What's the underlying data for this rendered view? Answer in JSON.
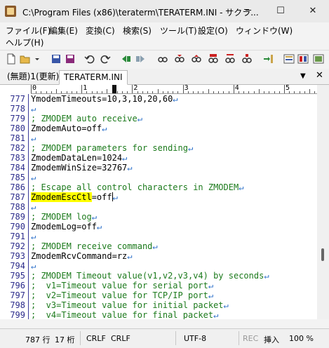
{
  "window": {
    "title": "C:\\Program Files (x86)\\teraterm\\TERATERM.INI - サクラ...",
    "minimize": "─",
    "maximize": "☐",
    "close": "✕"
  },
  "menu": {
    "items": [
      "ファイル(F)",
      "編集(E)",
      "変換(C)",
      "検索(S)",
      "ツール(T)",
      "設定(O)",
      "ウィンドウ(W)",
      "ヘルプ(H)"
    ]
  },
  "tabs": {
    "items": [
      "(無題)1(更新)",
      "TERATERM.INI"
    ],
    "active": 1,
    "dropdown": "▼",
    "close": "✕"
  },
  "ruler": {
    "numbers": [
      "0",
      "1",
      "2",
      "3",
      "4",
      "5"
    ]
  },
  "editor": {
    "lines": [
      {
        "n": "777",
        "t": "YmodemTimeouts=10,3,10,20,60",
        "c": false
      },
      {
        "n": "778",
        "t": "",
        "c": false
      },
      {
        "n": "779",
        "t": "; ZMODEM auto receive",
        "c": true
      },
      {
        "n": "780",
        "t": "ZmodemAuto=off",
        "c": false
      },
      {
        "n": "781",
        "t": "",
        "c": false
      },
      {
        "n": "782",
        "t": "; ZMODEM parameters for sending",
        "c": true
      },
      {
        "n": "783",
        "t": "ZmodemDataLen=1024",
        "c": false
      },
      {
        "n": "784",
        "t": "ZmodemWinSize=32767",
        "c": false
      },
      {
        "n": "785",
        "t": "",
        "c": false
      },
      {
        "n": "786",
        "t": "; Escape all control characters in ZMODEM",
        "c": true
      },
      {
        "n": "787",
        "t": "ZmodemEscCtl=off",
        "c": false,
        "hl": "ZmodemEscCtl"
      },
      {
        "n": "788",
        "t": "",
        "c": false
      },
      {
        "n": "789",
        "t": "; ZMODEM log",
        "c": true
      },
      {
        "n": "790",
        "t": "ZmodemLog=off",
        "c": false
      },
      {
        "n": "791",
        "t": "",
        "c": false
      },
      {
        "n": "792",
        "t": "; ZMODEM receive command",
        "c": true
      },
      {
        "n": "793",
        "t": "ZmodemRcvCommand=rz",
        "c": false
      },
      {
        "n": "794",
        "t": "",
        "c": false
      },
      {
        "n": "795",
        "t": "; ZMODEM Timeout value(v1,v2,v3,v4) by seconds",
        "c": true
      },
      {
        "n": "796",
        "t": ";  v1=Timeout value for serial port",
        "c": true
      },
      {
        "n": "797",
        "t": ";  v2=Timeout value for TCP/IP port",
        "c": true
      },
      {
        "n": "798",
        "t": ";  v3=Timeout value for initial packet",
        "c": true
      },
      {
        "n": "799",
        "t": ";  v4=Timeout value for final packet",
        "c": true
      }
    ],
    "newline_mark": "↵"
  },
  "status": {
    "line": "787 行",
    "col": "17 桁",
    "eol1": "CRLF",
    "eol2": "CRLF",
    "encoding": "UTF-8",
    "rec": "REC",
    "insert": "挿入",
    "zoom": "100 %"
  },
  "colors": {
    "comment": "#1c7a1c",
    "linenum": "#2a2a8a",
    "highlight": "#ffff00",
    "newline": "#2a6fc9"
  }
}
